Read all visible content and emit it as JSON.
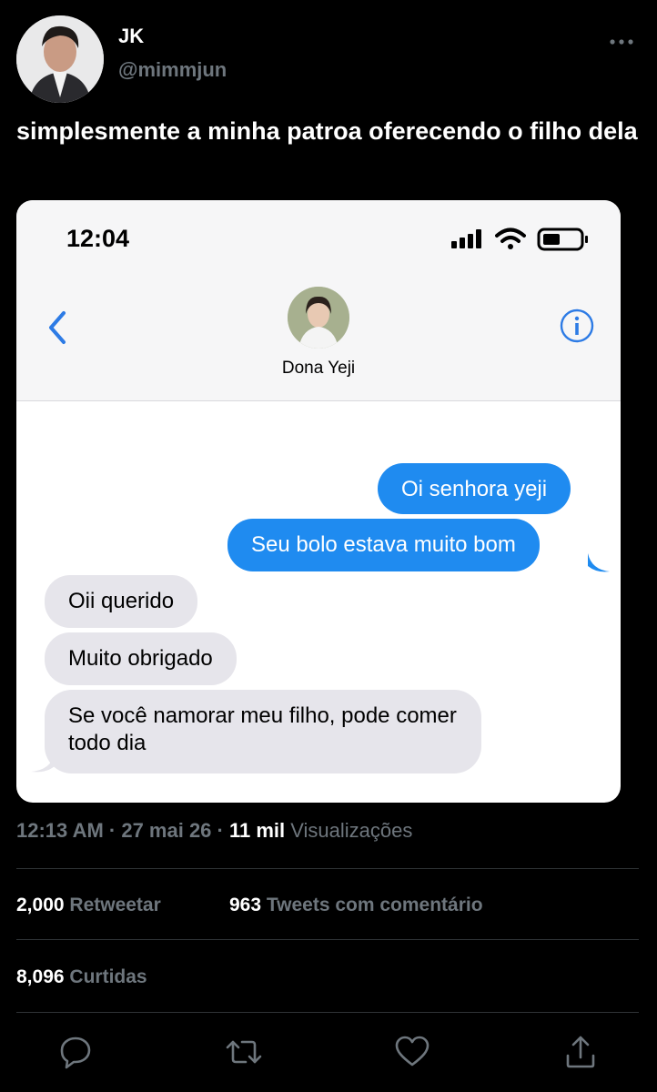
{
  "tweet": {
    "author_name": "JK",
    "author_handle": "@mimmjun",
    "text": " simplesmente a minha patroa oferecendo o filho dela"
  },
  "screenshot": {
    "status_time": "12:04",
    "contact_name": "Dona Yeji",
    "messages": [
      {
        "from": "me",
        "text": "Oi senhora yeji"
      },
      {
        "from": "me",
        "text": "Seu bolo estava muito bom"
      },
      {
        "from": "them",
        "text": "Oii querido"
      },
      {
        "from": "them",
        "text": "Muito obrigado"
      },
      {
        "from": "them",
        "text": "Se você namorar meu filho, pode comer todo dia"
      }
    ]
  },
  "meta": {
    "time": "12:13 AM",
    "sep1": " · ",
    "date": "27 mai 26",
    "sep2": " · ",
    "views_count": "11 mil",
    "views_label": "Visualizações"
  },
  "stats": {
    "retweets_count": "2,000",
    "retweets_label": "Retweetar",
    "quotes_count": "963",
    "quotes_label": "Tweets com comentário",
    "likes_count": "8,096",
    "likes_label": "Curtidas"
  },
  "colors": {
    "background": "#000000",
    "muted_text": "#6e767d",
    "imessage_blue": "#1f8bf0",
    "imessage_gray": "#e6e5eb",
    "ios_accent": "#2d7be5"
  },
  "icons": [
    "more-icon",
    "back-chevron-icon",
    "info-icon",
    "signal-icon",
    "wifi-icon",
    "battery-icon",
    "reply-icon",
    "retweet-icon",
    "like-icon",
    "share-icon"
  ]
}
